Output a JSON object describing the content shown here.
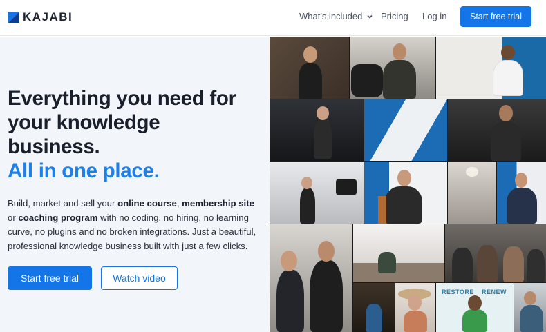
{
  "brand": {
    "name": "KAJABI",
    "color": "#1475e8"
  },
  "nav": {
    "whats_included": "What's included",
    "pricing": "Pricing",
    "login": "Log in",
    "cta": "Start free trial"
  },
  "hero": {
    "headline_1": "Everything you need for",
    "headline_2": "your knowledge",
    "headline_3": "business.",
    "headline_accent": "All in one place.",
    "sub_1": "Build, market and sell your ",
    "sub_b1": "online course",
    "sub_2": ", ",
    "sub_b2": "membership site",
    "sub_3": " or ",
    "sub_b3": "coaching program",
    "sub_4": " with no coding, no hiring, no learning curve, no plugins and no broken integrations. Just a beautiful, professional knowledge business built with just a few clicks.",
    "primary_cta": "Start free trial",
    "secondary_cta": "Watch video"
  },
  "photos": {
    "banner_left": "RESTORE",
    "banner_right": "RENEW"
  }
}
